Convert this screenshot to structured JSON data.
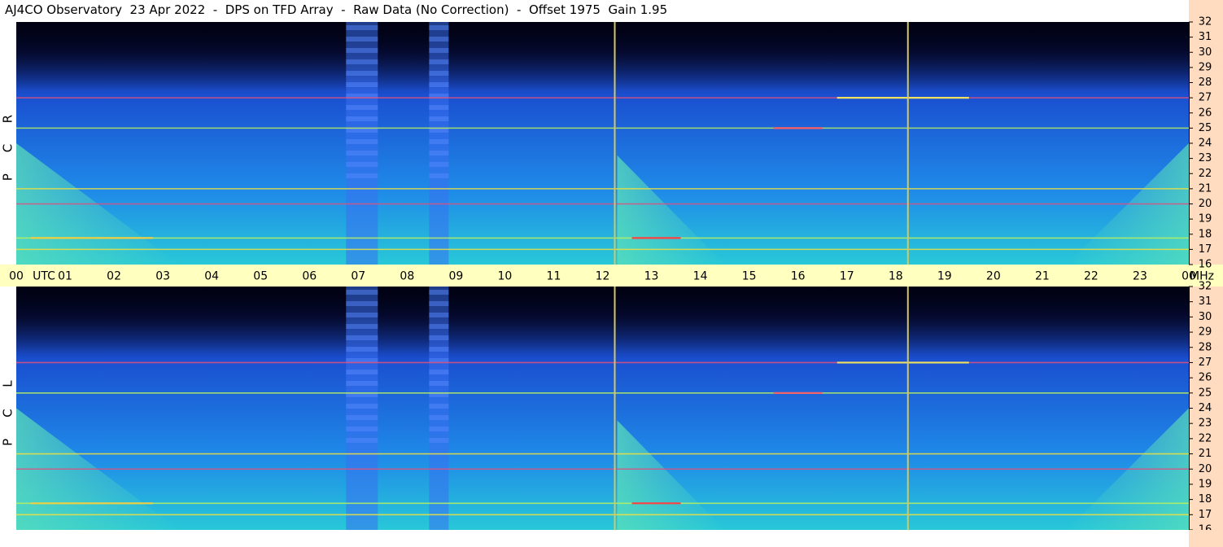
{
  "title": "AJ4CO Observatory  23 Apr 2022  -  DPS on TFD Array  -  Raw Data (No Correction)  -  Offset 1975  Gain 1.95",
  "colors": {
    "background": "#ffffff",
    "time_band": "#ffffc0",
    "freq_band": "#ffdcc0",
    "marker_line": "#d4c860",
    "spectrogram_bg": "#0a1a6a",
    "spectrogram_sky": "#1e5fe0",
    "spectrogram_hot": "#3ad6c8"
  },
  "chart_data": [
    {
      "type": "heatmap",
      "panel": "top",
      "polarization_label": [
        "R",
        "C",
        "P"
      ],
      "x_unit": "UTC",
      "y_unit": "MHz",
      "xlim": [
        0,
        24
      ],
      "ylim": [
        16,
        32
      ],
      "y_ticks": [
        "16",
        "17",
        "18",
        "19",
        "20",
        "21",
        "22",
        "23",
        "24",
        "25",
        "26",
        "27",
        "28",
        "29",
        "30",
        "31",
        "32"
      ],
      "marker_lines_utc": [
        12.25,
        18.25
      ],
      "broadband_bursts_utc": [
        [
          6.75,
          7.4
        ],
        [
          8.45,
          8.85
        ]
      ],
      "persistent_lines_mhz": [
        17.0,
        17.75,
        20.0,
        21.0,
        25.0,
        27.0
      ]
    },
    {
      "type": "heatmap",
      "panel": "bottom",
      "polarization_label": [
        "L",
        "C",
        "P"
      ],
      "x_unit": "UTC",
      "y_unit": "MHz",
      "xlim": [
        0,
        24
      ],
      "ylim": [
        16,
        32
      ],
      "y_ticks": [
        "16",
        "17",
        "18",
        "19",
        "20",
        "21",
        "22",
        "23",
        "24",
        "25",
        "26",
        "27",
        "28",
        "29",
        "30",
        "31",
        "32"
      ],
      "marker_lines_utc": [
        12.25,
        18.25
      ],
      "broadband_bursts_utc": [
        [
          6.75,
          7.4
        ],
        [
          8.45,
          8.85
        ]
      ],
      "persistent_lines_mhz": [
        17.0,
        17.75,
        20.0,
        21.0,
        25.0,
        27.0
      ]
    }
  ],
  "time_axis": {
    "labels": [
      "00",
      "01",
      "02",
      "03",
      "04",
      "05",
      "06",
      "07",
      "08",
      "09",
      "10",
      "11",
      "12",
      "13",
      "14",
      "15",
      "16",
      "17",
      "18",
      "19",
      "20",
      "21",
      "22",
      "23",
      "00"
    ],
    "unit_left": "UTC",
    "unit_right": "MHz"
  }
}
